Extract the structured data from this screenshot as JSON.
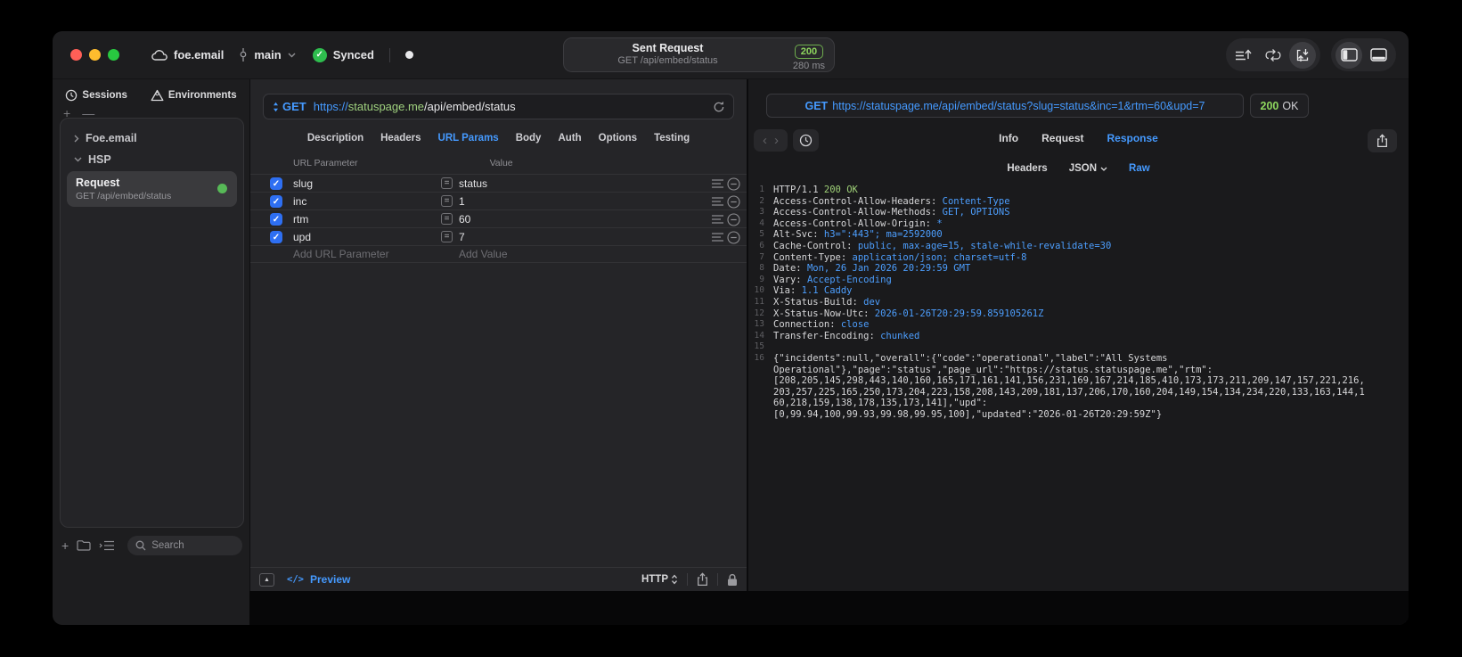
{
  "titlebar": {
    "project": "foe.email",
    "branch": "main",
    "sync_label": "Synced",
    "center": {
      "title": "Sent Request",
      "subtitle": "GET /api/embed/status",
      "status_code": "200",
      "duration": "280 ms"
    }
  },
  "sidebar": {
    "tabs": [
      {
        "label": "Sessions"
      },
      {
        "label": "Environments"
      }
    ],
    "group_collapsed": "Foe.email",
    "group_expanded": "HSP",
    "request": {
      "title": "Request",
      "subtitle": "GET /api/embed/status"
    },
    "search_placeholder": "Search"
  },
  "request_panel": {
    "method": "GET",
    "url": {
      "protocol": "https://",
      "host": "statuspage.me",
      "path": "/api/embed/status"
    },
    "tabs": [
      "Description",
      "Headers",
      "URL Params",
      "Body",
      "Auth",
      "Options",
      "Testing"
    ],
    "active_tab": "URL Params",
    "params": {
      "col_name": "URL Parameter",
      "col_value": "Value",
      "rows": [
        {
          "name": "slug",
          "value": "status",
          "enabled": true
        },
        {
          "name": "inc",
          "value": "1",
          "enabled": true
        },
        {
          "name": "rtm",
          "value": "60",
          "enabled": true
        },
        {
          "name": "upd",
          "value": "7",
          "enabled": true
        }
      ],
      "add_name": "Add URL Parameter",
      "add_value": "Add Value"
    },
    "footer": {
      "preview_label": "Preview",
      "format_label": "HTTP"
    }
  },
  "response_panel": {
    "request_line": {
      "method": "GET",
      "url": "https://statuspage.me/api/embed/status?slug=status&inc=1&rtm=60&upd=7"
    },
    "status": {
      "code": "200",
      "text": "OK"
    },
    "tabs": [
      "Info",
      "Request",
      "Response"
    ],
    "active_tab": "Response",
    "subtabs": [
      "Headers",
      "JSON",
      "Raw"
    ],
    "active_subtab": "Raw",
    "body": {
      "status_line": {
        "no": "1",
        "plain": "HTTP/1.1 ",
        "status": "200 OK"
      },
      "headers": [
        {
          "no": "2",
          "key": "Access-Control-Allow-Headers: ",
          "val": "Content-Type"
        },
        {
          "no": "3",
          "key": "Access-Control-Allow-Methods: ",
          "val": "GET, OPTIONS"
        },
        {
          "no": "4",
          "key": "Access-Control-Allow-Origin: ",
          "val": "*"
        },
        {
          "no": "5",
          "key": "Alt-Svc: ",
          "val": "h3=\":443\"; ma=2592000"
        },
        {
          "no": "6",
          "key": "Cache-Control: ",
          "val": "public, max-age=15, stale-while-revalidate=30"
        },
        {
          "no": "7",
          "key": "Content-Type: ",
          "val": "application/json; charset=utf-8"
        },
        {
          "no": "8",
          "key": "Date: ",
          "val": "Mon, 26 Jan 2026 20:29:59 GMT"
        },
        {
          "no": "9",
          "key": "Vary: ",
          "val": "Accept-Encoding"
        },
        {
          "no": "10",
          "key": "Via: ",
          "val": "1.1 Caddy"
        },
        {
          "no": "11",
          "key": "X-Status-Build: ",
          "val": "dev"
        },
        {
          "no": "12",
          "key": "X-Status-Now-Utc: ",
          "val": "2026-01-26T20:29:59.859105261Z"
        },
        {
          "no": "13",
          "key": "Connection: ",
          "val": "close"
        },
        {
          "no": "14",
          "key": "Transfer-Encoding: ",
          "val": "chunked"
        }
      ],
      "blank_line_no": "15",
      "json_line_no": "16",
      "json_lines": [
        "{\"incidents\":null,\"overall\":{\"code\":\"operational\",\"label\":\"All Systems",
        "Operational\"},\"page\":\"status\",\"page_url\":\"https://status.statuspage.me\",\"rtm\":",
        "[208,205,145,298,443,140,160,165,171,161,141,156,231,169,167,214,185,410,173,173,211,209,147,157,221,216,",
        "203,257,225,165,250,173,204,223,158,208,143,209,181,137,206,170,160,204,149,154,134,234,220,133,163,144,1",
        "60,218,159,138,178,135,173,141],\"upd\":",
        "[0,99.94,100,99.93,99.98,99.95,100],\"updated\":\"2026-01-26T20:29:59Z\"}"
      ]
    }
  }
}
